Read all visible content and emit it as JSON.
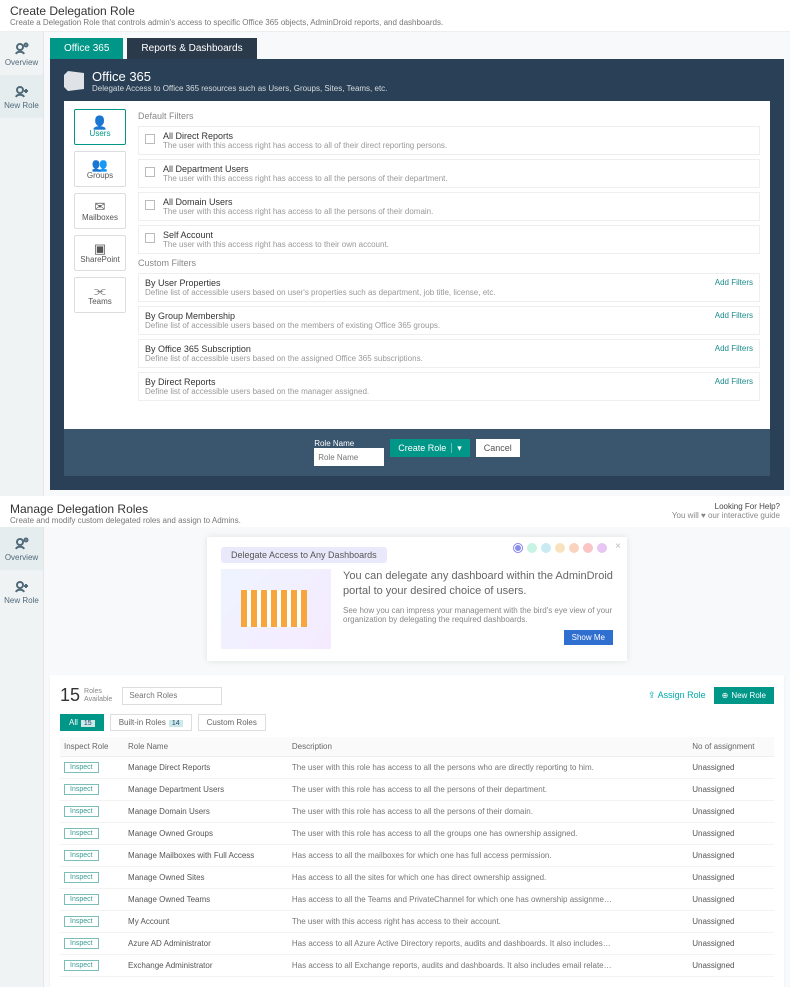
{
  "create": {
    "title": "Create Delegation Role",
    "subtitle": "Create a Delegation Role that controls admin's access to specific Office 365 objects, AdminDroid reports, and dashboards.",
    "sidenav": [
      {
        "label": "Overview"
      },
      {
        "label": "New Role"
      }
    ],
    "tabs": [
      {
        "label": "Office 365"
      },
      {
        "label": "Reports & Dashboards"
      }
    ],
    "banner": {
      "title": "Office 365",
      "sub": "Delegate Access to Office 365 resources such as Users, Groups, Sites, Teams, etc."
    },
    "objects": [
      {
        "label": "Users",
        "icon": "👤"
      },
      {
        "label": "Groups",
        "icon": "👥"
      },
      {
        "label": "Mailboxes",
        "icon": "✉"
      },
      {
        "label": "SharePoint",
        "icon": "▣"
      },
      {
        "label": "Teams",
        "icon": "⫘"
      }
    ],
    "default_label": "Default Filters",
    "default_filters": [
      {
        "title": "All Direct Reports",
        "desc": "The user with this access right has access to all of their direct reporting persons."
      },
      {
        "title": "All Department Users",
        "desc": "The user with this access right has access to all the persons of their department."
      },
      {
        "title": "All Domain Users",
        "desc": "The user with this access right has access to all the persons of their domain."
      },
      {
        "title": "Self Account",
        "desc": "The user with this access right has access to their own account."
      }
    ],
    "custom_label": "Custom Filters",
    "add_filter": "Add Filters",
    "custom_filters": [
      {
        "title": "By User Properties",
        "desc": "Define list of accessible users based on user's properties such as department, job title, license, etc."
      },
      {
        "title": "By Group Membership",
        "desc": "Define list of accessible users based on the members of existing Office 365 groups."
      },
      {
        "title": "By Office 365 Subscription",
        "desc": "Define list of accessible users based on the assigned Office 365 subscriptions."
      },
      {
        "title": "By Direct Reports",
        "desc": "Define list of accessible users based on the manager assigned."
      }
    ],
    "role_name_label": "Role Name",
    "role_name_placeholder": "Role Name",
    "create_btn": "Create Role",
    "cancel_btn": "Cancel"
  },
  "manage": {
    "title": "Manage Delegation Roles",
    "subtitle": "Create and modify custom delegated roles and assign to Admins.",
    "help_title": "Looking For Help?",
    "help_sub_pre": "You will ",
    "help_sub_post": " our interactive guide",
    "sidenav": [
      {
        "label": "Overview"
      },
      {
        "label": "New Role"
      }
    ],
    "info": {
      "chip": "Delegate Access to Any Dashboards",
      "quote": "You can delegate any dashboard within the AdminDroid portal to your desired choice of users.",
      "sub": "See how you can impress your management with the bird's eye view of your organization by delegating the required dashboards.",
      "showme": "Show Me",
      "dots": [
        "#8b8be8",
        "#8fe7c8",
        "#8fd5e7",
        "#f3c77d",
        "#f3a77d",
        "#f38b8b",
        "#d28be7"
      ]
    },
    "count": {
      "n": "15",
      "l1": "Roles",
      "l2": "Available"
    },
    "search_placeholder": "Search Roles",
    "assign": "Assign Role",
    "newrole": "New Role",
    "tabs": {
      "all": "All",
      "all_n": "15",
      "builtin": "Built-in Roles",
      "builtin_n": "14",
      "custom": "Custom Roles"
    },
    "cols": {
      "inspect": "Inspect Role",
      "name": "Role Name",
      "desc": "Description",
      "assign": "No of assignment"
    },
    "inspect_label": "Inspect",
    "rows": [
      {
        "name": "Manage Direct Reports",
        "desc": "The user with this role has access to all the persons who are directly reporting to him.",
        "assign": "Unassigned"
      },
      {
        "name": "Manage Department Users",
        "desc": "The user with this role has access to all the persons of their department.",
        "assign": "Unassigned"
      },
      {
        "name": "Manage Domain Users",
        "desc": "The user with this role has access to all the persons of their domain.",
        "assign": "Unassigned"
      },
      {
        "name": "Manage Owned Groups",
        "desc": "The user with this role has access to all the groups one has ownership assigned.",
        "assign": "Unassigned"
      },
      {
        "name": "Manage Mailboxes with Full Access",
        "desc": "Has access to all the mailboxes for which one has full access permission.",
        "assign": "Unassigned"
      },
      {
        "name": "Manage Owned Sites",
        "desc": "Has access to all the sites for which one has direct ownership assigned.",
        "assign": "Unassigned"
      },
      {
        "name": "Manage Owned Teams",
        "desc": "Has access to all the Teams and PrivateChannel for which one has ownership assignme…",
        "assign": "Unassigned"
      },
      {
        "name": "My Account",
        "desc": "The user with this access right has access to their account.",
        "assign": "Unassigned"
      },
      {
        "name": "Azure AD Administrator",
        "desc": "Has access to all Azure Active Directory reports, audits and dashboards. It also includes…",
        "assign": "Unassigned"
      },
      {
        "name": "Exchange Administrator",
        "desc": "Has access to all Exchange reports, audits and dashboards. It also includes email relate…",
        "assign": "Unassigned"
      }
    ]
  }
}
